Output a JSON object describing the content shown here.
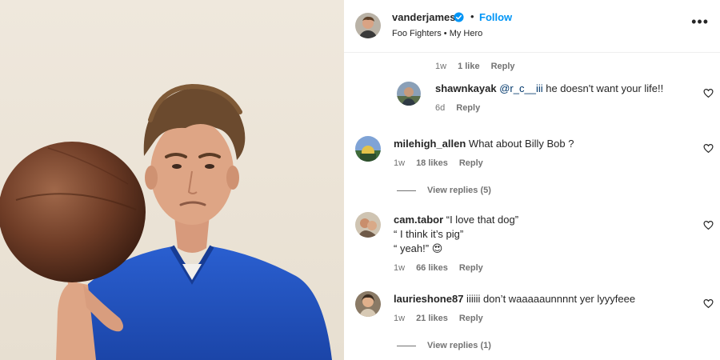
{
  "post": {
    "username": "vanderjames",
    "follow_label": "Follow",
    "separator": "•",
    "subtitle": "Foo Fighters • My Hero",
    "more_label": "•••"
  },
  "colors": {
    "accent": "#0095f6",
    "muted": "#737373",
    "text": "#262626"
  },
  "top_meta": {
    "time": "1w",
    "likes": "1 like",
    "reply": "Reply"
  },
  "comments": [
    {
      "username": "shawnkayak",
      "mention": "@r_c__iii",
      "text": " he doesn't want your life!!",
      "time": "6d",
      "likes": "",
      "reply": "Reply"
    },
    {
      "username": "milehigh_allen",
      "text": " What about Billy Bob ?",
      "time": "1w",
      "likes": "18 likes",
      "reply": "Reply",
      "view_replies": "View replies (5)"
    },
    {
      "username": "cam.tabor",
      "text": " “I love that dog”",
      "line2": "“ I think it’s pig”",
      "line3": "“ yeah!” ",
      "emoji": "😍",
      "time": "1w",
      "likes": "66 likes",
      "reply": "Reply"
    },
    {
      "username": "laurieshone87",
      "text": " iiiiii don’t waaaaaunnnnt yer lyyyfeee",
      "time": "1w",
      "likes": "21 likes",
      "reply": "Reply",
      "view_replies": "View replies (1)"
    }
  ],
  "icons": {
    "verified": "verified-badge-icon",
    "heart": "heart-icon",
    "more": "more-options-icon"
  }
}
